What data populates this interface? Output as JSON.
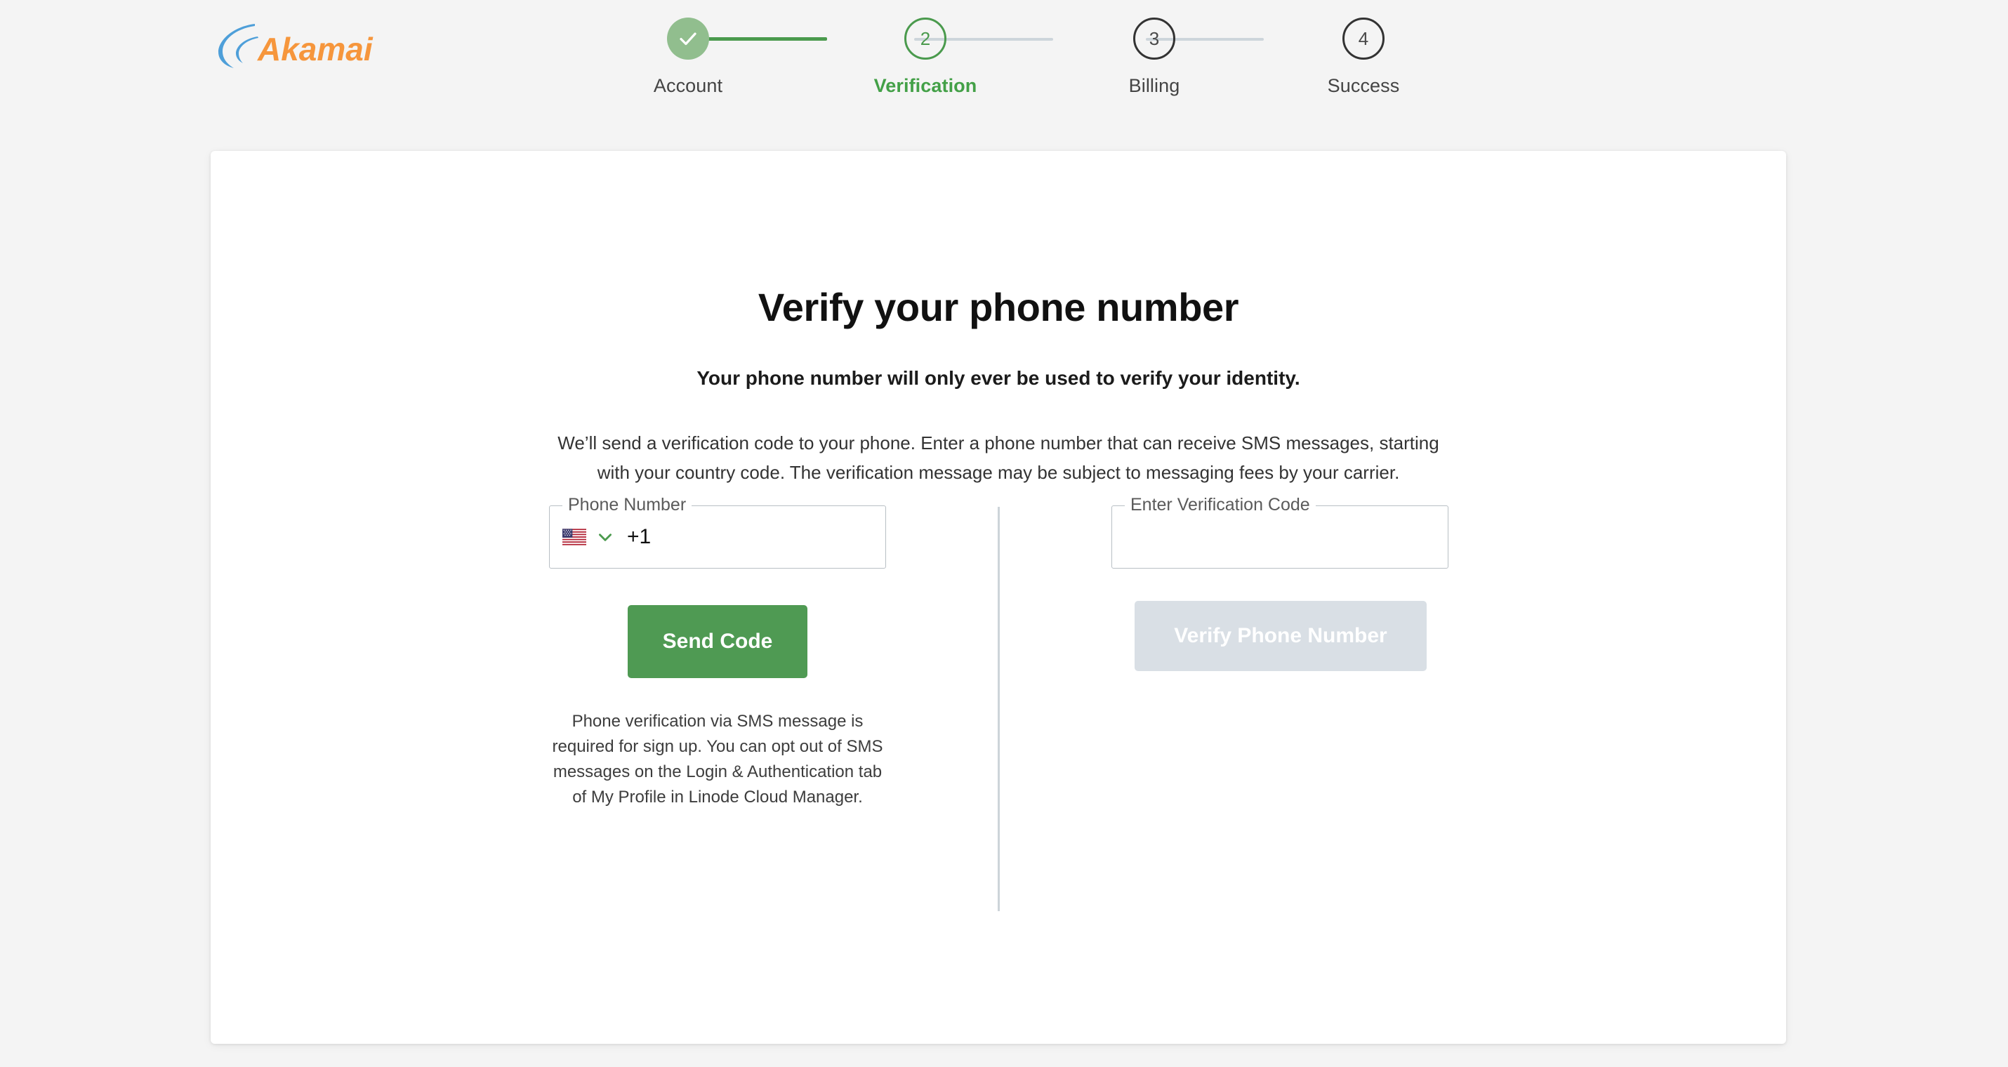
{
  "brand": {
    "name": "Akamai",
    "logo_icon": "akamai-logo",
    "wave_color": "#4e9fd9",
    "wordmark_color": "#f6963c"
  },
  "stepper": {
    "steps": [
      {
        "number": "",
        "label": "Account",
        "state": "completed",
        "icon": "check-icon"
      },
      {
        "number": "2",
        "label": "Verification",
        "state": "active",
        "icon": ""
      },
      {
        "number": "3",
        "label": "Billing",
        "state": "upcoming",
        "icon": ""
      },
      {
        "number": "4",
        "label": "Success",
        "state": "upcoming",
        "icon": ""
      }
    ],
    "colors": {
      "completed_fill": "#91be8e",
      "active_outline": "#4a9a4d",
      "upcoming_outline": "#333333",
      "connector_done": "#4a9a4d",
      "connector_todo": "#cdd5db",
      "active_label": "#43a047"
    }
  },
  "main": {
    "title": "Verify your phone number",
    "subtitle": "Your phone number will only ever be used to verify your identity.",
    "description": "We’ll send a verification code to your phone. Enter a phone number that can receive SMS messages, starting with your country code. The verification message may be subject to messaging fees by your carrier."
  },
  "phone_form": {
    "field_label": "Phone Number",
    "country_flag_icon": "us-flag-icon",
    "country_flag_emoji": "🇺🇸",
    "dropdown_icon": "chevron-down-icon",
    "dial_code": "+1",
    "phone_value": "",
    "phone_placeholder": "",
    "send_button_label": "Send Code",
    "send_button_color": "#4f9a53",
    "helper_text": "Phone verification via SMS message is required for sign up. You can opt out of SMS messages on the Login & Authentication tab of My Profile in Linode Cloud Manager."
  },
  "verify_form": {
    "field_label": "Enter Verification Code",
    "code_value": "",
    "code_placeholder": "",
    "verify_button_label": "Verify Phone Number",
    "verify_button_color": "#d9dfe5",
    "verify_button_disabled": true
  }
}
